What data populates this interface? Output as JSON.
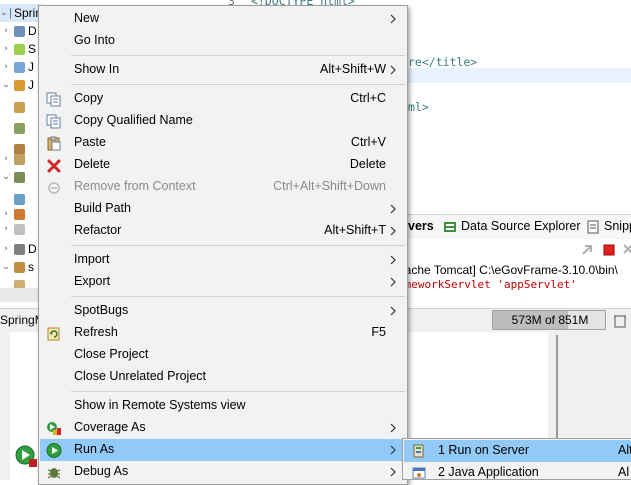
{
  "explorer": {
    "rows": [
      {
        "label": "Sprin",
        "arrow": "v"
      },
      {
        "label": "D",
        "arrow": ">"
      },
      {
        "label": "S",
        "arrow": ">"
      },
      {
        "label": "J",
        "arrow": ">"
      },
      {
        "label": "J",
        "arrow": "v"
      },
      {
        "label": "",
        "arrow": ""
      },
      {
        "label": "",
        "arrow": ""
      },
      {
        "label": "",
        "arrow": ""
      },
      {
        "label": "",
        "arrow": ">"
      },
      {
        "label": "",
        "arrow": "v"
      },
      {
        "label": "",
        "arrow": ""
      },
      {
        "label": "",
        "arrow": ">"
      },
      {
        "label": "",
        "arrow": ">"
      },
      {
        "label": "D",
        "arrow": ">"
      },
      {
        "label": "s",
        "arrow": "v"
      },
      {
        "label": "",
        "arrow": ""
      }
    ],
    "status_label": "SpringM"
  },
  "editor": {
    "line_number": "3",
    "lines": [
      {
        "text": "<!DOCTYPE html>",
        "cls": "tag"
      },
      {
        "text": "re</title>",
        "cls": "tag"
      },
      {
        "text": "ml>",
        "cls": "tag"
      }
    ]
  },
  "console": {
    "tabs": [
      "vers",
      "Data Source Explorer",
      "Snipp"
    ],
    "line1": "pache Tomcat] C:\\eGovFrame-3.10.0\\bin\\",
    "line2": "ameworkServlet 'appServlet'",
    "heap": "573M of 851M",
    "heap_fraction": 0.67
  },
  "menu": {
    "items": [
      {
        "label": "New",
        "shortcut": "",
        "submenu": true,
        "icon": "none",
        "disabled": false,
        "hover": false
      },
      {
        "label": "Go Into",
        "shortcut": "",
        "submenu": false,
        "icon": "none",
        "disabled": false,
        "hover": false
      },
      {
        "sep": true
      },
      {
        "label": "Show In",
        "shortcut": "Alt+Shift+W",
        "submenu": true,
        "icon": "none",
        "disabled": false,
        "hover": false
      },
      {
        "sep": true
      },
      {
        "label": "Copy",
        "shortcut": "Ctrl+C",
        "submenu": false,
        "icon": "copy-icon",
        "disabled": false,
        "hover": false
      },
      {
        "label": "Copy Qualified Name",
        "shortcut": "",
        "submenu": false,
        "icon": "copy-qualified-name-icon",
        "disabled": false,
        "hover": false
      },
      {
        "label": "Paste",
        "shortcut": "Ctrl+V",
        "submenu": false,
        "icon": "paste-icon",
        "disabled": false,
        "hover": false
      },
      {
        "label": "Delete",
        "shortcut": "Delete",
        "submenu": false,
        "icon": "delete-icon",
        "disabled": false,
        "hover": false
      },
      {
        "label": "Remove from Context",
        "shortcut": "Ctrl+Alt+Shift+Down",
        "submenu": false,
        "icon": "remove-context-icon",
        "disabled": true,
        "hover": false
      },
      {
        "label": "Build Path",
        "shortcut": "",
        "submenu": true,
        "icon": "none",
        "disabled": false,
        "hover": false
      },
      {
        "label": "Refactor",
        "shortcut": "Alt+Shift+T",
        "submenu": true,
        "icon": "none",
        "disabled": false,
        "hover": false
      },
      {
        "sep": true
      },
      {
        "label": "Import",
        "shortcut": "",
        "submenu": true,
        "icon": "none",
        "disabled": false,
        "hover": false
      },
      {
        "label": "Export",
        "shortcut": "",
        "submenu": true,
        "icon": "none",
        "disabled": false,
        "hover": false
      },
      {
        "sep": true
      },
      {
        "label": "SpotBugs",
        "shortcut": "",
        "submenu": true,
        "icon": "none",
        "disabled": false,
        "hover": false
      },
      {
        "label": "Refresh",
        "shortcut": "F5",
        "submenu": false,
        "icon": "refresh-icon",
        "disabled": false,
        "hover": false
      },
      {
        "label": "Close Project",
        "shortcut": "",
        "submenu": false,
        "icon": "none",
        "disabled": false,
        "hover": false
      },
      {
        "label": "Close Unrelated Project",
        "shortcut": "",
        "submenu": false,
        "icon": "none",
        "disabled": false,
        "hover": false
      },
      {
        "sep": true
      },
      {
        "label": "Show in Remote Systems view",
        "shortcut": "",
        "submenu": false,
        "icon": "none",
        "disabled": false,
        "hover": false
      },
      {
        "label": "Coverage As",
        "shortcut": "",
        "submenu": true,
        "icon": "coverage-icon",
        "disabled": false,
        "hover": false
      },
      {
        "label": "Run As",
        "shortcut": "",
        "submenu": true,
        "icon": "run-icon",
        "disabled": false,
        "hover": true
      },
      {
        "label": "Debug As",
        "shortcut": "",
        "submenu": true,
        "icon": "debug-icon",
        "disabled": false,
        "hover": false
      }
    ]
  },
  "submenu": {
    "items": [
      {
        "label": "1 Run on Server",
        "shortcut": "Alt",
        "icon": "server-icon",
        "hover": true
      },
      {
        "label": "2 Java Application",
        "shortcut": "Al",
        "icon": "java-app-icon",
        "hover": false
      }
    ]
  },
  "colors": {
    "menu_bg": "#f2f2f2",
    "hover_bg": "#91c9f7",
    "disabled_text": "#8a8a8a",
    "console_red": "#c00000"
  }
}
